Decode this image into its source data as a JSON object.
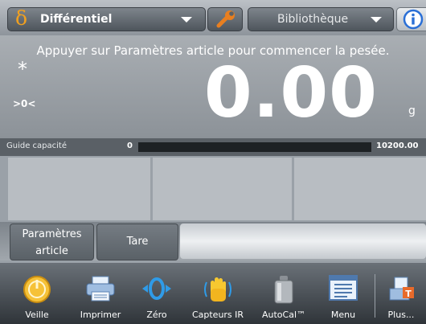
{
  "header": {
    "mode_glyph": "δ",
    "mode_label": "Différentiel",
    "library_label": "Bibliothèque",
    "info_icon": "info-icon",
    "settings_icon": "wrench-icon"
  },
  "display": {
    "prompt": "Appuyer sur Paramètres article pour commencer la pesée.",
    "stable_indicator": "*",
    "zero_indicator": ">0<",
    "weight": "0.00",
    "unit": "g"
  },
  "capacity": {
    "label": "Guide capacité",
    "min": "0",
    "max": "10200.00"
  },
  "softkeys": {
    "params_line1": "Paramètres",
    "params_line2": "article",
    "tare": "Tare"
  },
  "toolbar": {
    "items": [
      {
        "label": "Veille",
        "icon": "standby-icon"
      },
      {
        "label": "Imprimer",
        "icon": "printer-icon"
      },
      {
        "label": "Zéro",
        "icon": "zero-icon"
      },
      {
        "label": "Capteurs IR",
        "icon": "hand-sensor-icon"
      },
      {
        "label": "AutoCal™",
        "icon": "calibration-weight-icon"
      },
      {
        "label": "Menu",
        "icon": "menu-icon"
      },
      {
        "label": "Plus...",
        "icon": "more-icon"
      }
    ]
  },
  "colors": {
    "accent_orange": "#f0a020",
    "info_blue": "#2a6fd6"
  }
}
